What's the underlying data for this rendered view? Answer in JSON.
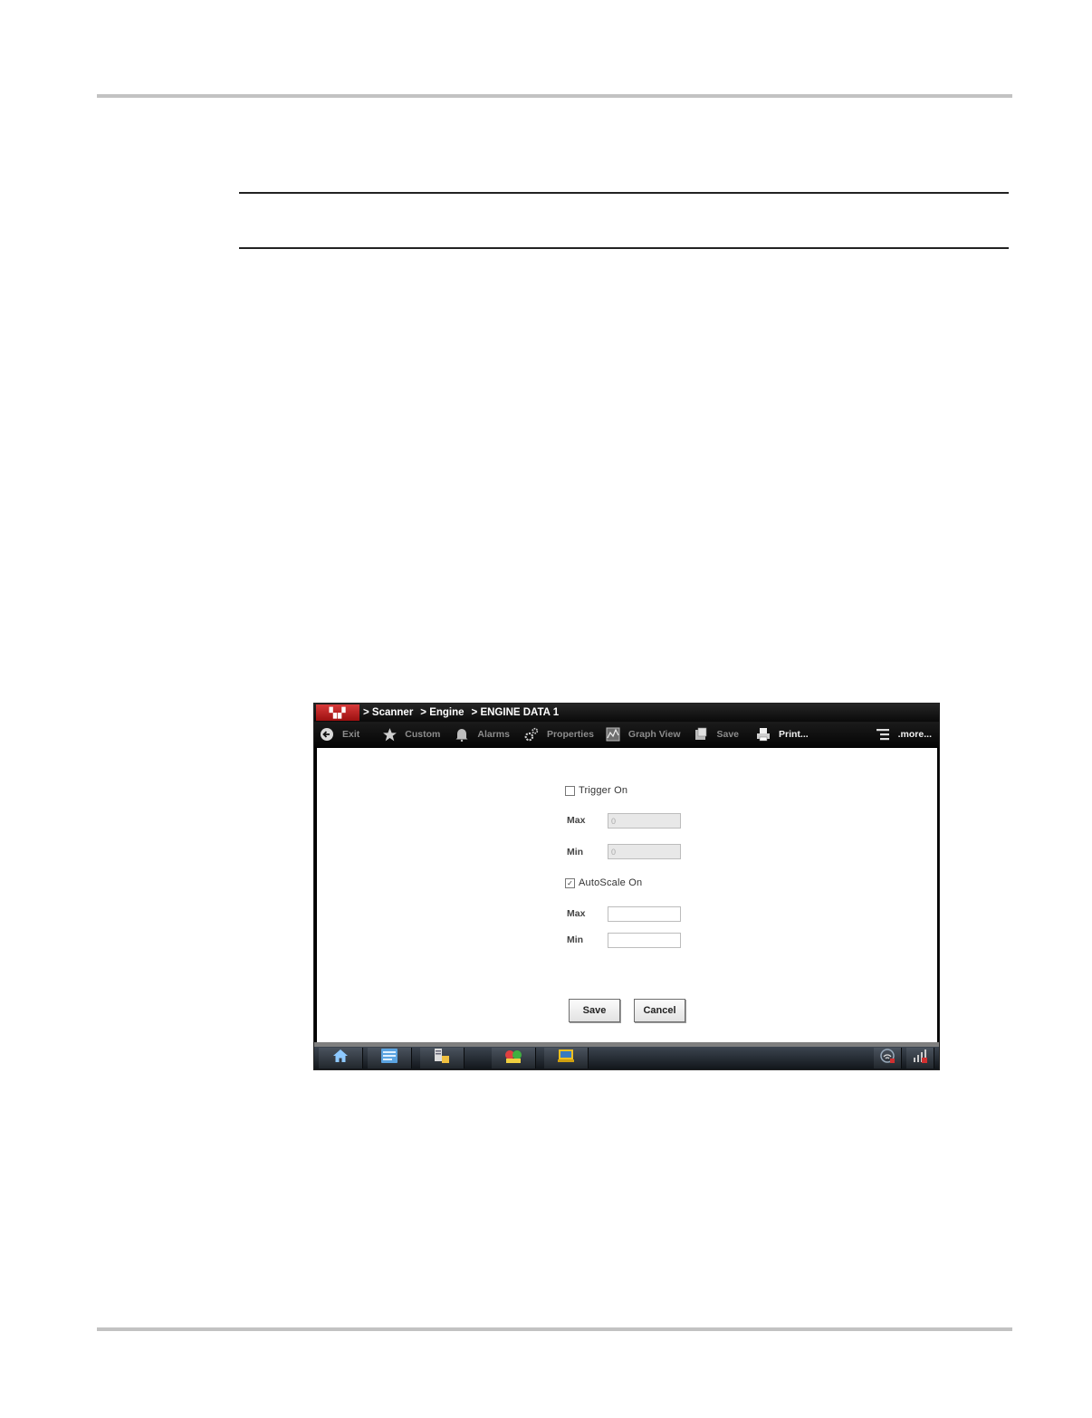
{
  "screen": {
    "breadcrumb": [
      "> Scanner",
      "> Engine",
      "> ENGINE DATA 1"
    ],
    "logo_icon": "brand-logo-icon",
    "toolbar": [
      {
        "label": "Exit",
        "icon": "exit-arrow-icon",
        "active": false
      },
      {
        "label": "Custom",
        "icon": "star-icon",
        "active": false
      },
      {
        "label": "Alarms",
        "icon": "bell-icon",
        "active": false
      },
      {
        "label": "Properties",
        "icon": "gear-icon",
        "active": false
      },
      {
        "label": "Graph View",
        "icon": "graph-icon",
        "active": false
      },
      {
        "label": "Save",
        "icon": "floppy-icon",
        "active": false
      },
      {
        "label": "Print...",
        "icon": "printer-icon",
        "active": true
      },
      {
        "label": ".more...",
        "icon": "menu-lines-icon",
        "active": true
      }
    ],
    "form": {
      "trigger": {
        "label": "Trigger On",
        "checked": false
      },
      "trigger_max": {
        "label": "Max",
        "value": "0",
        "enabled": false
      },
      "trigger_min": {
        "label": "Min",
        "value": "0",
        "enabled": false
      },
      "autoscale": {
        "label": "AutoScale On",
        "checked": true
      },
      "scale_max": {
        "label": "Max",
        "value": "",
        "enabled": true
      },
      "scale_min": {
        "label": "Min",
        "value": "",
        "enabled": true
      },
      "save_label": "Save",
      "cancel_label": "Cancel"
    },
    "taskbar": {
      "buttons": [
        "home-icon",
        "scanner-icon",
        "data-list-icon",
        "guided-icon",
        "shop-icon"
      ],
      "tray": [
        "wifi-icon",
        "signal-icon"
      ]
    },
    "colors": {
      "toolbar_bg": "#0a0a0a",
      "toolbar_text_dim": "#8c8c8c",
      "logo_red": "#c42222"
    }
  }
}
